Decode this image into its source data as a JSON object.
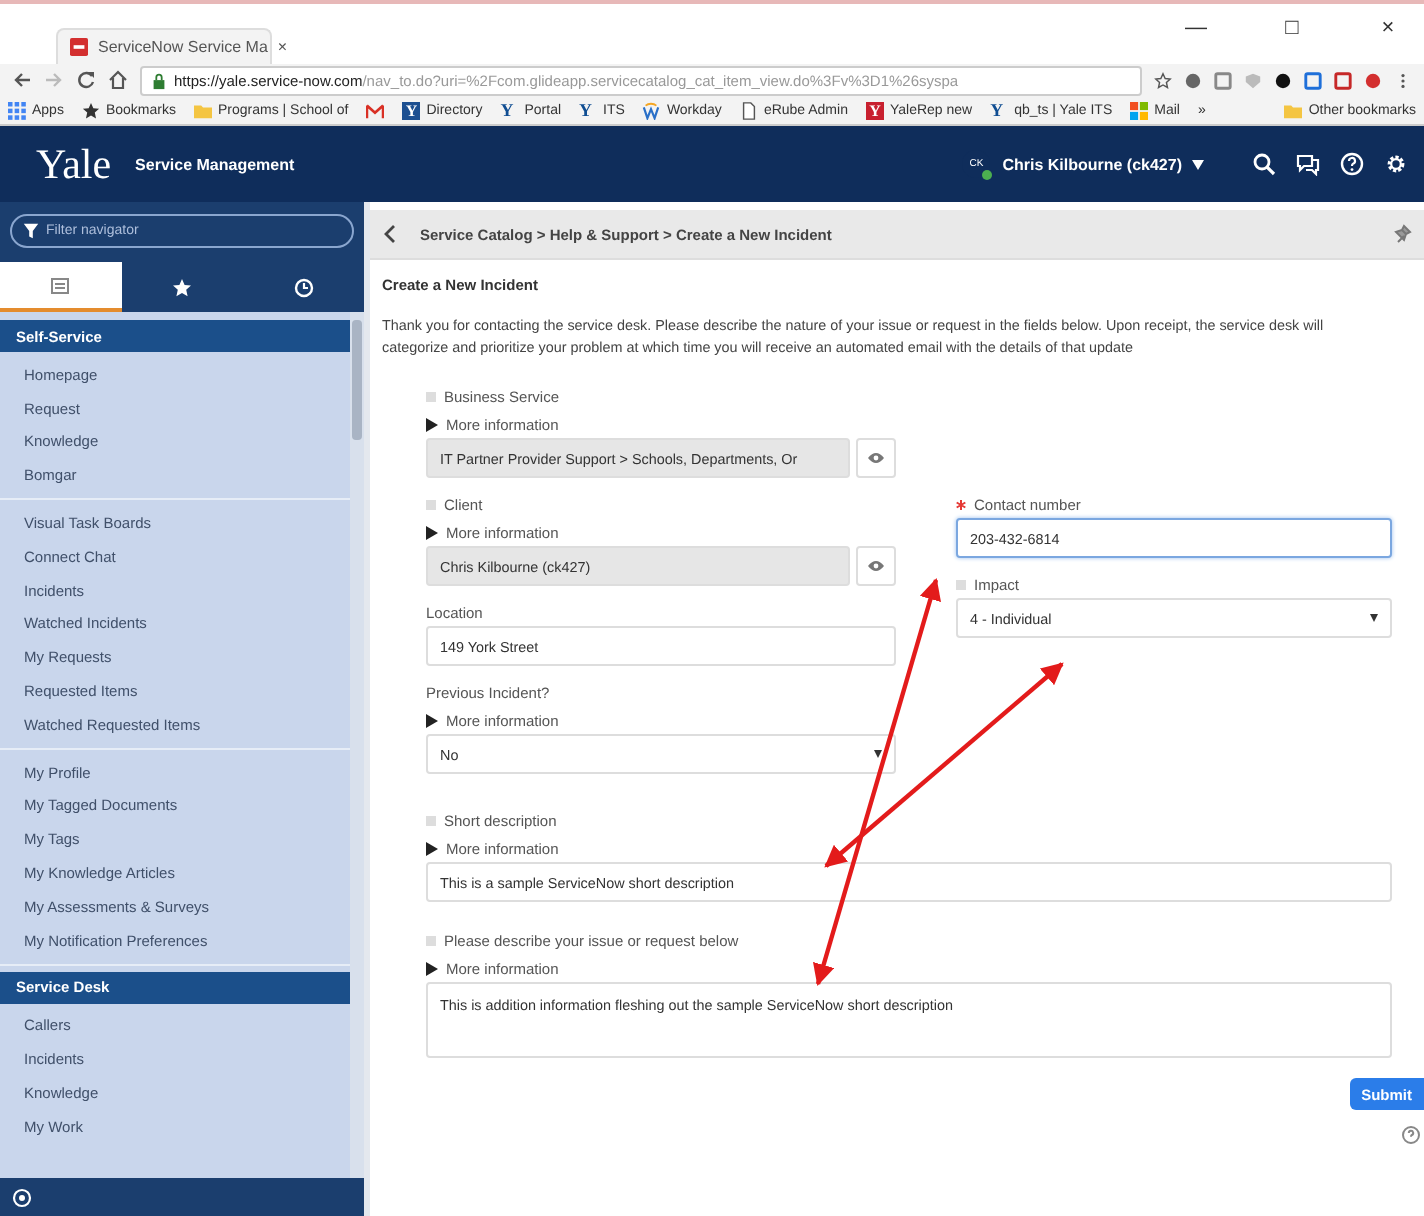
{
  "browser": {
    "tabs": [
      {
        "title": "ServiceNow Service Ma",
        "close": "×",
        "selected": true
      }
    ],
    "window_controls": [
      "—",
      "□",
      "×"
    ],
    "url": {
      "host": "https://yale.service-now.com",
      "path": "/nav_to.do?uri=%2Fcom.glideapp.servicecatalog_cat_item_view.do%3Fv%3D1%26syspa"
    },
    "bookmarks": [
      {
        "kind": "apps",
        "label": "Apps"
      },
      {
        "kind": "star",
        "label": "Bookmarks"
      },
      {
        "kind": "folder",
        "label": "Programs | School of"
      },
      {
        "kind": "gmail"
      },
      {
        "kind": "ysquare",
        "glyph": "Y",
        "label": "Directory"
      },
      {
        "kind": "y",
        "glyph": "Y",
        "label": "Portal"
      },
      {
        "kind": "y",
        "glyph": "Y",
        "label": "ITS"
      },
      {
        "kind": "workday",
        "label": "Workday"
      },
      {
        "kind": "page",
        "label": "eRube Admin"
      },
      {
        "kind": "yred",
        "glyph": "Y",
        "label": "YaleRep new"
      },
      {
        "kind": "y",
        "glyph": "Y",
        "label": "qb_ts | Yale ITS"
      },
      {
        "kind": "tiles",
        "label": "Mail"
      }
    ],
    "overflow": "»",
    "other_bookmarks": "Other bookmarks"
  },
  "header": {
    "logo": "Yale",
    "product": "Service Management",
    "user": {
      "initials": "CK",
      "name": "Chris Kilbourne (ck427)",
      "online": true
    }
  },
  "sidebar": {
    "filter": {
      "placeholder": "Filter navigator"
    },
    "tabs": [
      {
        "kind": "list",
        "selected": true
      },
      {
        "kind": "star",
        "selected": false
      },
      {
        "kind": "history",
        "selected": false
      }
    ],
    "sections": [
      {
        "title": "Self-Service",
        "groups": [
          [
            "Homepage",
            "Request",
            "Knowledge",
            "Bomgar"
          ],
          [
            "Visual Task Boards",
            "Connect Chat",
            "Incidents",
            "Watched Incidents",
            "My Requests",
            "Requested Items",
            "Watched Requested Items"
          ],
          [
            "My Profile",
            "My Tagged Documents",
            "My Tags",
            "My Knowledge Articles",
            "My Assessments & Surveys",
            "My Notification Preferences"
          ]
        ]
      },
      {
        "title": "Service Desk",
        "groups": [
          [
            "Callers",
            "Incidents",
            "Knowledge",
            "My Work"
          ]
        ]
      }
    ]
  },
  "breadcrumb": "Service Catalog > Help & Support > Create a New Incident",
  "form": {
    "title": "Create a New Incident",
    "intro": "Thank you for contacting the service desk. Please describe the nature of your issue or request in the fields below. Upon receipt, the service desk will categorize and prioritize your problem at which time you will receive an automated email with the details of that update",
    "top": [
      {
        "kind": "reference",
        "label": "Business Service",
        "mandatory": true,
        "alert": false,
        "more_info": "More information",
        "value": "IT Partner Provider Support > Schools, Departments, Or"
      }
    ],
    "left": [
      {
        "kind": "reference",
        "label": "Client",
        "mandatory": true,
        "alert": false,
        "more_info": "More information",
        "value": "Chris Kilbourne (ck427)"
      },
      {
        "kind": "text",
        "label": "Location",
        "mandatory": false,
        "alert": false,
        "value": "149 York Street",
        "focused": false
      },
      {
        "kind": "select",
        "label": "Previous Incident?",
        "mandatory": false,
        "alert": false,
        "more_info": "More information",
        "value": "No"
      }
    ],
    "right": [
      {
        "kind": "text",
        "label": "Contact number",
        "mandatory": true,
        "alert": true,
        "value": "203-432-6814",
        "focused": true
      },
      {
        "kind": "select",
        "label": "Impact",
        "mandatory": true,
        "alert": false,
        "value": "4 - Individual"
      }
    ],
    "bottom": [
      {
        "kind": "text",
        "label": "Short description",
        "mandatory": true,
        "alert": false,
        "more_info": "More information",
        "value": "This is a sample ServiceNow short description",
        "focused": false
      },
      {
        "kind": "textarea",
        "label": "Please describe your issue or request below",
        "mandatory": true,
        "alert": false,
        "more_info": "More information",
        "value": "This is addition information fleshing out the sample ServiceNow short description"
      }
    ]
  },
  "submit": "Submit"
}
